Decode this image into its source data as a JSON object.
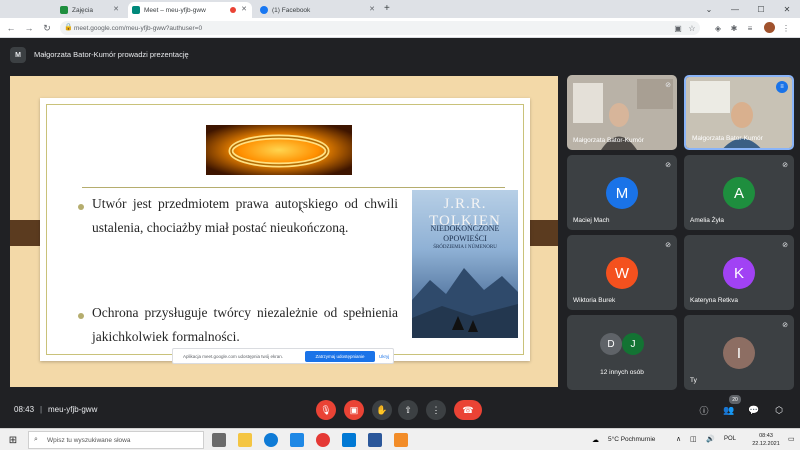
{
  "browser": {
    "tabs": [
      {
        "label": "Zajęcia",
        "color": "#1e8e3e"
      },
      {
        "label": "Meet – meu-yfjb-gww",
        "color": "#00897b"
      },
      {
        "label": "(1) Facebook",
        "color": "#1877f2"
      }
    ],
    "new_tab": "+",
    "url": "meet.google.com/meu-yfjb-gww?authuser=0"
  },
  "presenter": {
    "initial": "M",
    "text": "Małgorzata Bator-Kumór prowadzi prezentację"
  },
  "slide": {
    "bullet1": "Utwór jest przedmiotem prawa autorskiego od chwili ustalenia, chociażby miał postać nieukończoną.",
    "bullet2": "Ochrona przysługuje twórcy niezależnie od spełnienia jakichkolwiek formalności.",
    "cover_author": "J.R.R. TOLKIEN",
    "cover_title_1": "NIEDOKOŃCZONE",
    "cover_title_2": "OPOWIEŚCI",
    "cover_title_3": "ŚRÓDZIEMIA I NÚMENORU"
  },
  "notice": {
    "text": "Aplikacja meet.google.com udostępnia twój ekran.",
    "button": "Zatrzymaj udostępnianie",
    "close": "Ukryj"
  },
  "participants": [
    {
      "name": "Małgorzata Bator-Kumór",
      "initial": "",
      "color": ""
    },
    {
      "name": "Małgorzata Bator-Kumór",
      "initial": "",
      "color": ""
    },
    {
      "name": "Maciej Mach",
      "initial": "M",
      "color": "#1a73e8"
    },
    {
      "name": "Amelia Żyła",
      "initial": "A",
      "color": "#1e8e3e"
    },
    {
      "name": "Wiktoria Burek",
      "initial": "W",
      "color": "#f4511e"
    },
    {
      "name": "Kateryna Retkva",
      "initial": "K",
      "color": "#a142f4"
    },
    {
      "name": "12 innych osób",
      "initial": "D",
      "initial2": "J",
      "color": "#5f6368",
      "color2": "#137333"
    },
    {
      "name": "Ty",
      "initial": "I",
      "color": "#8d6e63"
    }
  ],
  "meetbar": {
    "time": "08:43",
    "separator": "|",
    "code": "meu-yfjb-gww",
    "people_count": "20"
  },
  "taskbar": {
    "search_placeholder": "Wpisz tu wyszukiwane słowa",
    "weather": "5°C Pochmurnie",
    "lang": "POL",
    "time": "08:43",
    "date": "22.12.2021"
  }
}
